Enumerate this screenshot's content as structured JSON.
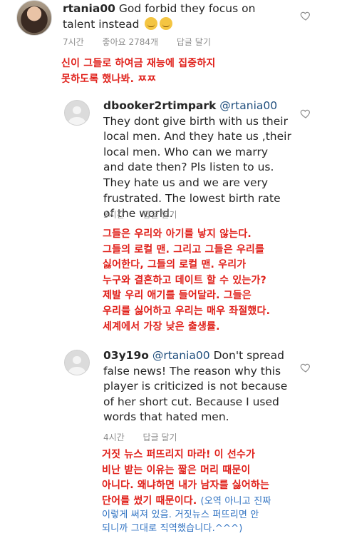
{
  "comments": [
    {
      "username": "rtania00",
      "text": "God forbid they focus on talent instead",
      "emoji": [
        "unamused-face",
        "unamused-face"
      ],
      "time": "7시간",
      "likes": "좋아요 2784개",
      "reply": "답글 달기"
    },
    {
      "username": "dbooker2rtimpark",
      "mention": "@rtania00",
      "text": "They dont give birth with us their local men. And they hate us ,their local men. Who can we marry and date then? Pls listen to us. They hate us and we are very frustrated. The lowest birth rate of the world.",
      "time": "3시간",
      "reply": "답글 달기"
    },
    {
      "username": "03y19o",
      "mention": "@rtania00",
      "text": "Don't spread false news! The reason why this player is criticized is not because of her short cut. Because I used words that hated men.",
      "time": "4시간",
      "reply": "답글 달기"
    }
  ],
  "translations": {
    "t1": [
      "신이 그들로 하여금 재능에 집중하지",
      "못하도록 했나봐. ㅉㅉ"
    ],
    "t2": [
      "그들은 우리와 아기를 낳지 않는다.",
      "그들의 로컬 맨. 그리고 그들은 우리를",
      "싫어한다, 그들의 로컬 맨. 우리가",
      "누구와 결혼하고 데이트 할 수 있는가?",
      "제발 우리 애기를 들어달라. 그들은",
      "우리를 싫어하고 우리는 매우 좌절했다.",
      "세계에서 가장 낮은 출생률."
    ],
    "t3": [
      "거짓 뉴스 퍼뜨리지 마라! 이 선수가",
      "비난 받는 이유는 짧은 머리 때문이",
      "아니다. 왜냐하면 내가 남자를 싫어하는"
    ],
    "t3_last": "단어를 썼기 때문이다.",
    "note_start": "(오역 아니고 진짜",
    "note_lines": [
      "이렇게 써져 있음. 거짓뉴스 퍼뜨리면 안",
      "되니까 그대로 직역했습니다.^^^)"
    ]
  },
  "colors": {
    "translation": "#e0201a",
    "note": "#2f72c2",
    "meta": "#8e8e8e",
    "mention": "#1f4e7d"
  },
  "icons": [
    "heart-icon",
    "avatar-default"
  ]
}
